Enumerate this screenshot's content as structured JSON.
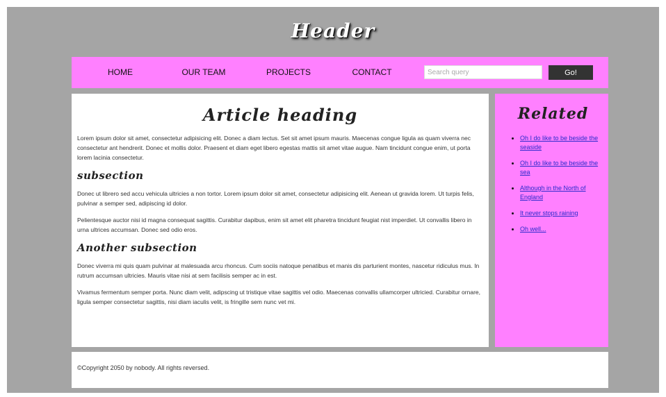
{
  "header": {
    "title": "Header"
  },
  "nav": {
    "items": [
      "HOME",
      "OUR TEAM",
      "PROJECTS",
      "CONTACT"
    ],
    "search_placeholder": "Search query",
    "go_label": "Go!"
  },
  "article": {
    "heading": "Article heading",
    "intro": "Lorem ipsum dolor sit amet, consectetur adipisicing elit. Donec a diam lectus. Set sit amet ipsum mauris. Maecenas congue ligula as quam viverra nec consectetur ant hendrerit. Donec et mollis dolor. Praesent et diam eget libero egestas mattis sit amet vitae augue. Nam tincidunt congue enim, ut porta lorem lacinia consectetur.",
    "subsection_heading": "subsection",
    "subsection_p1": "Donec ut librero sed accu vehicula ultricies a non tortor. Lorem ipsum dolor sit amet, consectetur adipisicing elit. Aenean ut gravida lorem. Ut turpis felis, pulvinar a semper sed, adipiscing id dolor.",
    "subsection_p2": "Pelientesque auctor nisi id magna consequat sagittis. Curabitur dapibus, enim sit amet elit pharetra tincidunt feugiat nist imperdiet. Ut convallis libero in urna ultrices accumsan. Donec sed odio eros.",
    "another_heading": "Another subsection",
    "another_p1": "Donec viverra mi quis quam pulvinar at malesuada arcu rhoncus. Cum sociis natoque penatibus et manis dis parturient montes, nascetur ridiculus mus. In rutrum accumsan ultricies. Mauris vitae nisi at sem facilisis semper ac in est.",
    "another_p2": "Vivamus fermentum semper porta. Nunc diam velit, adipscing ut tristique vitae sagittis vel odio. Maecenas convallis ullamcorper ultricied. Curabitur ornare, ligula semper consectetur sagittis, nisi diam iaculis velit, is fringille sem nunc vet mi."
  },
  "sidebar": {
    "heading": "Related",
    "links": [
      "Oh I do like to be beside the seaside",
      "Oh I do like to be beside the sea",
      "Although in the North of England",
      "It never stops raining",
      "Oh well..."
    ]
  },
  "footer": {
    "text": "©Copyright 2050 by nobody. All rights reversed."
  },
  "colors": {
    "background": "#a5a5a5",
    "nav": "#ff80ff",
    "sidebar": "#ff80ff",
    "button": "#333333"
  }
}
